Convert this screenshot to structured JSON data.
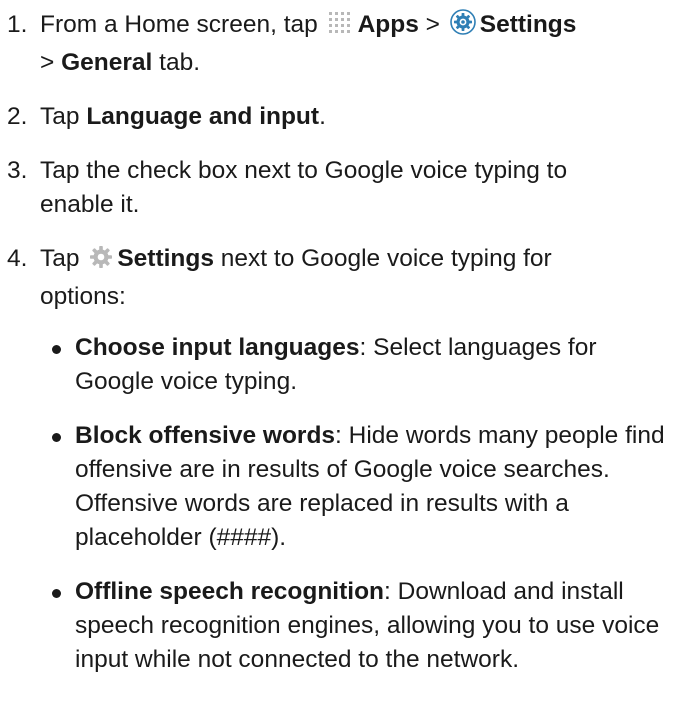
{
  "steps": [
    {
      "num": "1.",
      "pre": "From a Home screen, tap ",
      "icon1": "apps-grid-icon",
      "bold1": "Apps",
      "mid": " > ",
      "icon2": "settings-icon",
      "bold2": "Settings",
      "line2_pre": "> ",
      "bold3": "General",
      "post": " tab."
    },
    {
      "num": "2.",
      "pre": "Tap ",
      "bold1": "Language and input",
      "post": "."
    },
    {
      "num": "3.",
      "text": "Tap the check box next to Google voice typing to enable it."
    },
    {
      "num": "4.",
      "pre": "Tap ",
      "icon1": "gear-icon",
      "bold1": "Settings",
      "post": " next to Google voice typing for options:"
    }
  ],
  "bullets": [
    {
      "term": "Choose input languages",
      "desc": ": Select languages for Google voice typing."
    },
    {
      "term": "Block offensive words",
      "desc": ": Hide words many people find offensive are in results of Google voice searches. Offensive words are replaced in results with a placeholder (####)."
    },
    {
      "term": "Offline speech recognition",
      "desc": ": Download and install speech recognition engines, allowing you to use voice input while not connected to the network."
    }
  ],
  "colors": {
    "text": "#1a1a1a",
    "icon_gray": "#b8b8b8",
    "settings_blue": "#2f7fb5"
  }
}
